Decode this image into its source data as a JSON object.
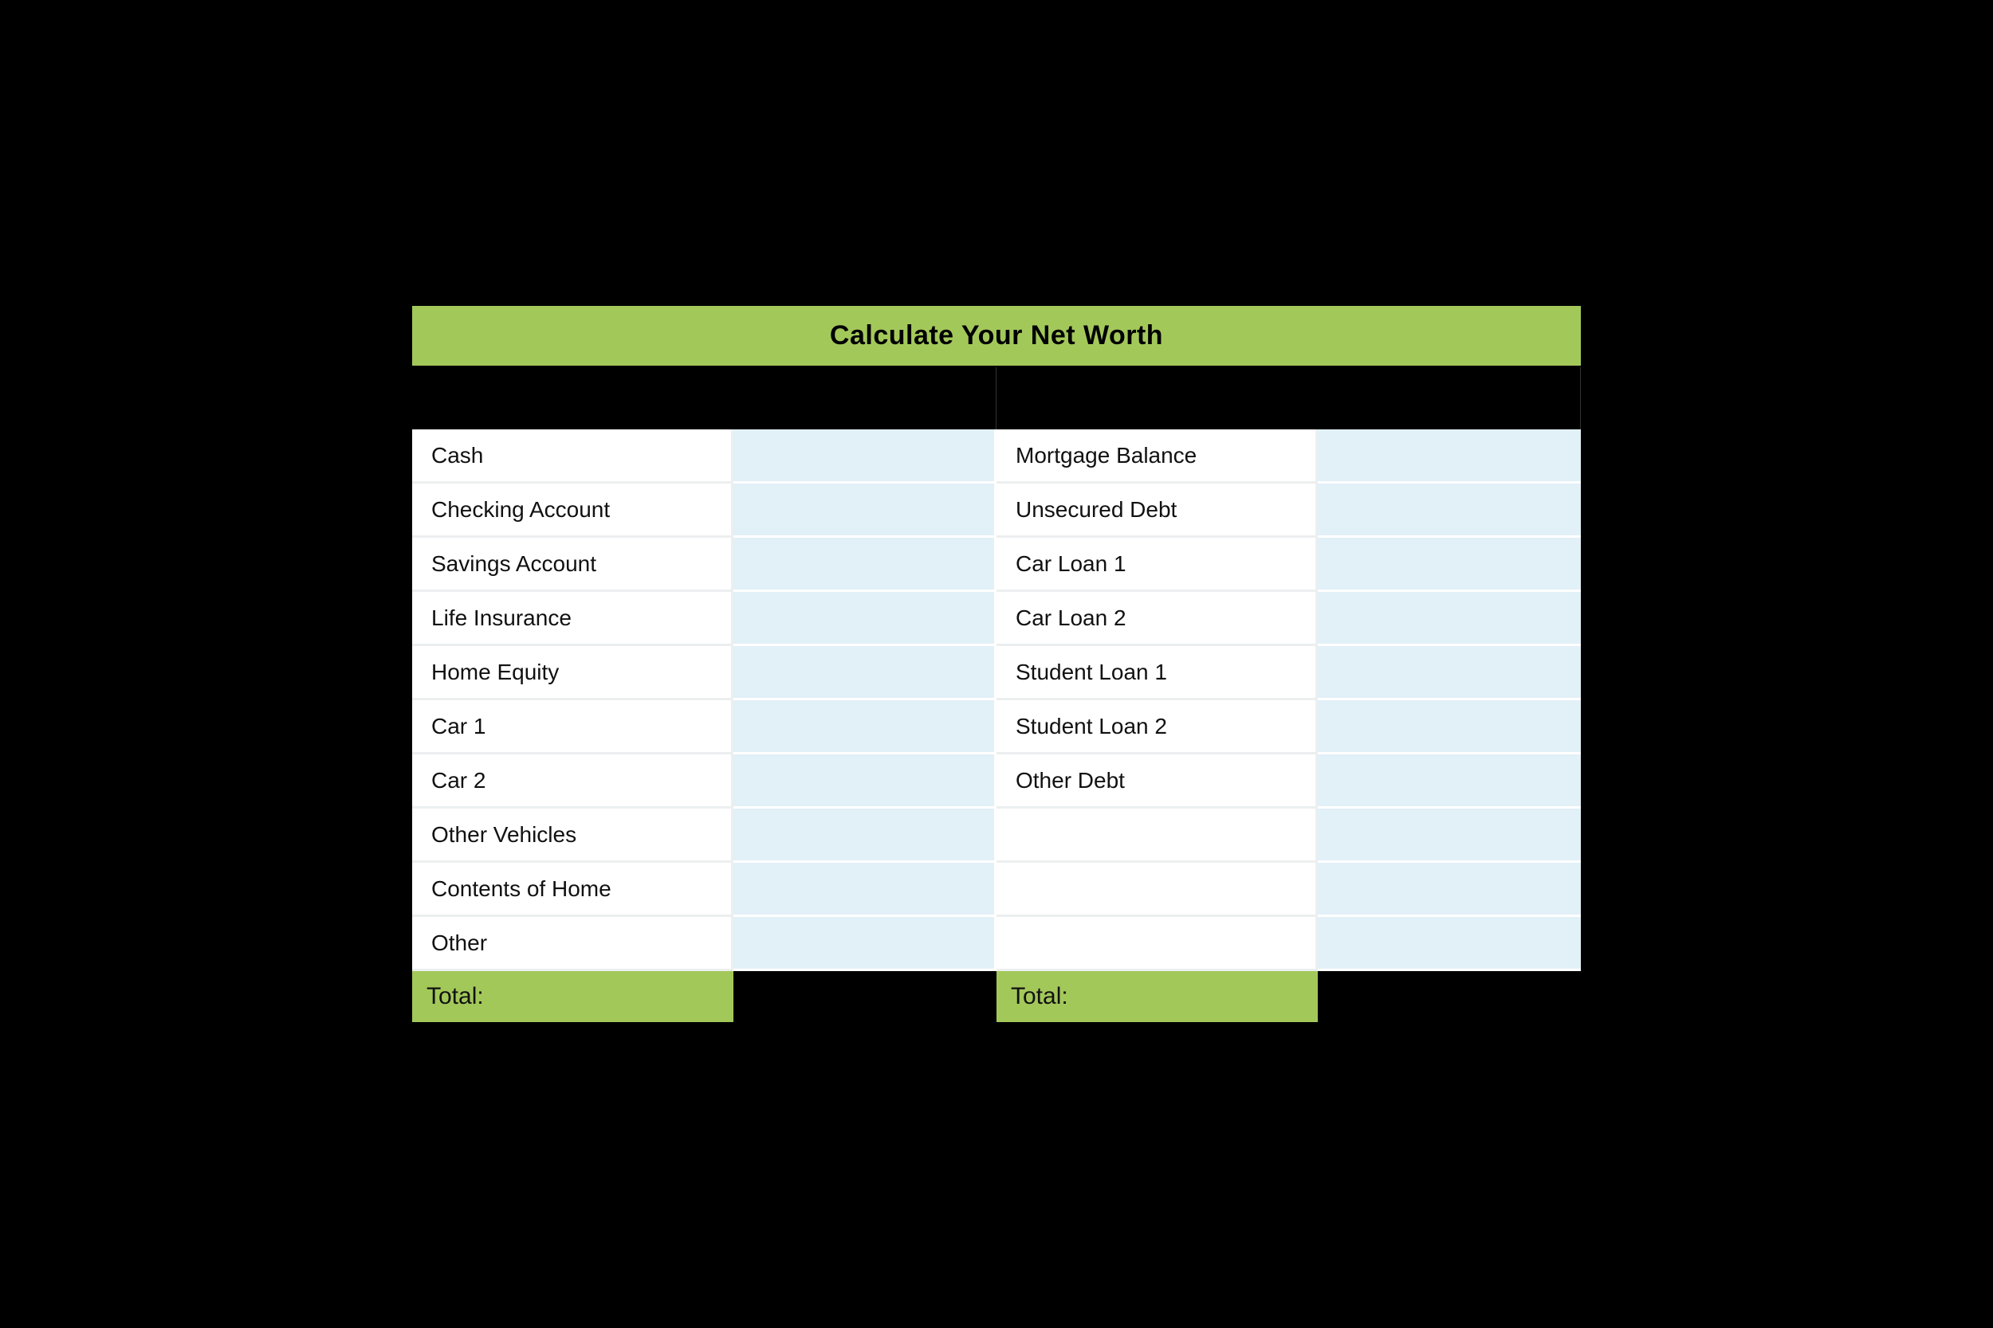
{
  "title": "Calculate Your Net Worth",
  "assets": {
    "rows": [
      {
        "label": "Cash",
        "value": ""
      },
      {
        "label": "Checking Account",
        "value": ""
      },
      {
        "label": "Savings Account",
        "value": ""
      },
      {
        "label": "Life Insurance",
        "value": ""
      },
      {
        "label": "Home Equity",
        "value": ""
      },
      {
        "label": "Car 1",
        "value": ""
      },
      {
        "label": "Car 2",
        "value": ""
      },
      {
        "label": "Other Vehicles",
        "value": ""
      },
      {
        "label": "Contents of Home",
        "value": ""
      },
      {
        "label": "Other",
        "value": ""
      }
    ],
    "total_label": "Total:",
    "total_value": ""
  },
  "liabilities": {
    "rows": [
      {
        "label": "Mortgage Balance",
        "value": ""
      },
      {
        "label": "Unsecured Debt",
        "value": ""
      },
      {
        "label": "Car Loan 1",
        "value": ""
      },
      {
        "label": "Car Loan 2",
        "value": ""
      },
      {
        "label": "Student Loan 1",
        "value": ""
      },
      {
        "label": "Student Loan 2",
        "value": ""
      },
      {
        "label": "Other Debt",
        "value": ""
      },
      {
        "label": "",
        "value": ""
      },
      {
        "label": "",
        "value": ""
      },
      {
        "label": "",
        "value": ""
      }
    ],
    "total_label": "Total:",
    "total_value": ""
  },
  "colors": {
    "accent_green": "#a3c85a",
    "value_blue": "#e2f0f7",
    "header_black": "#000000"
  }
}
